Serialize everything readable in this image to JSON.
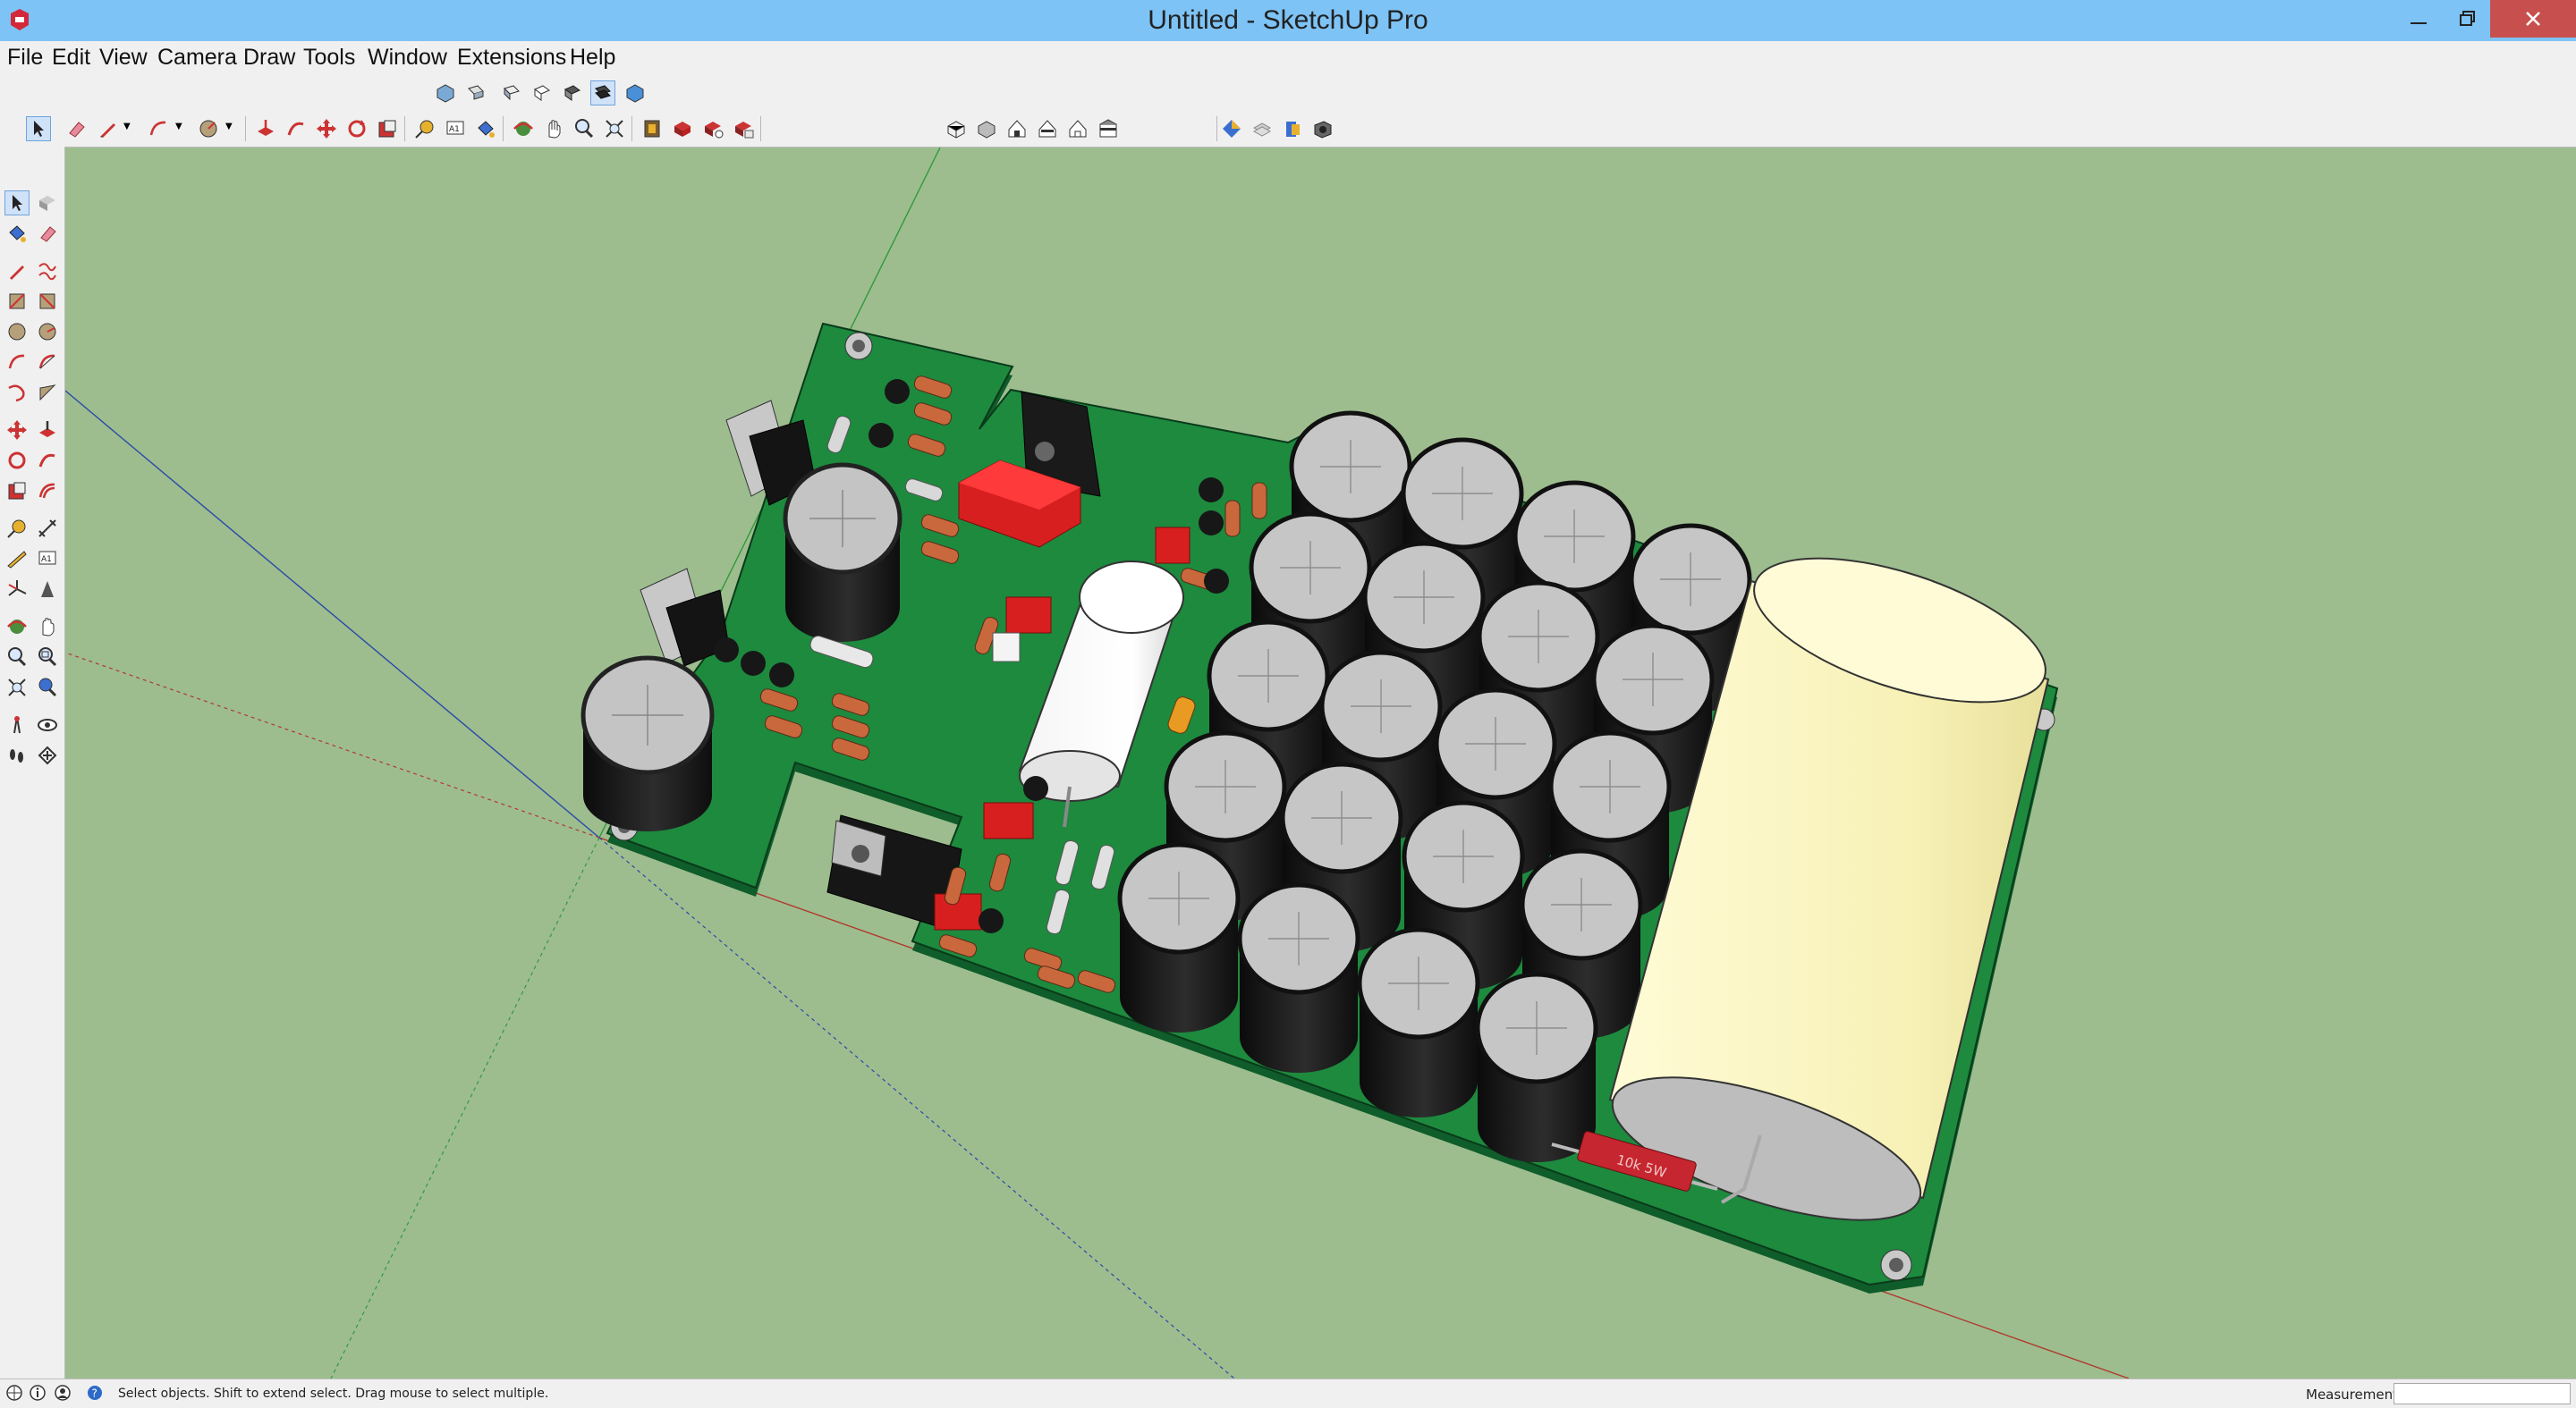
{
  "window": {
    "title": "Untitled - SketchUp Pro"
  },
  "menu": {
    "items": [
      "File",
      "Edit",
      "View",
      "Camera",
      "Draw",
      "Tools",
      "Window",
      "Extensions",
      "Help"
    ]
  },
  "toolbars": {
    "views_icons": [
      "iso-view-icon",
      "top-view-icon",
      "front-view-icon",
      "right-view-icon",
      "back-view-icon",
      "left-view-icon",
      "section-icon",
      "xray-icon"
    ],
    "main_icons": [
      "select-icon",
      "eraser-icon",
      "pencil-icon",
      "arc-icon",
      "circle-icon",
      "push-pull-icon",
      "follow-me-icon",
      "move-icon",
      "rotate-icon",
      "scale-icon",
      "tape-icon",
      "text-icon",
      "paint-icon",
      "orbit-icon",
      "pan-icon",
      "zoom-icon",
      "zoom-extents-icon",
      "warehouse-icon",
      "extension-icon",
      "component-icon",
      "ruby-icon"
    ],
    "style_icons": [
      "xray-style-icon",
      "wireframe-icon",
      "hidden-line-icon",
      "shaded-icon",
      "textured-icon",
      "monochrome-icon"
    ],
    "extra_icons": [
      "sandbox-icon",
      "layers-icon",
      "scenes-icon",
      "camera-icon"
    ]
  },
  "left_tools": [
    "select",
    "component",
    "paint",
    "eraser",
    "line",
    "freehand",
    "rectangle",
    "rotated-rectangle",
    "circle",
    "polygon",
    "arc",
    "two-point-arc",
    "three-point-arc",
    "pie",
    "move",
    "push-pull",
    "rotate",
    "follow-me",
    "scale",
    "offset",
    "tape",
    "dimension",
    "protractor",
    "text",
    "axes",
    "3d-text",
    "orbit",
    "pan",
    "zoom",
    "zoom-window",
    "zoom-extents",
    "previous",
    "position-camera",
    "look-around",
    "walk",
    "section-plane"
  ],
  "colors": {
    "titlebar": "#7ec3f5",
    "viewport": "#9dbd8f",
    "pcb": "#1d8a3e",
    "cap_body": "#181818",
    "cap_top": "#c4c4c4",
    "large_cap": "#f8f3c0"
  },
  "status": {
    "message": "Select objects. Shift to extend select. Drag mouse to select multiple.",
    "measurements_label": "Measurements",
    "measurements_value": ""
  },
  "model_labels": {
    "red_resistor": "10k 5W"
  }
}
